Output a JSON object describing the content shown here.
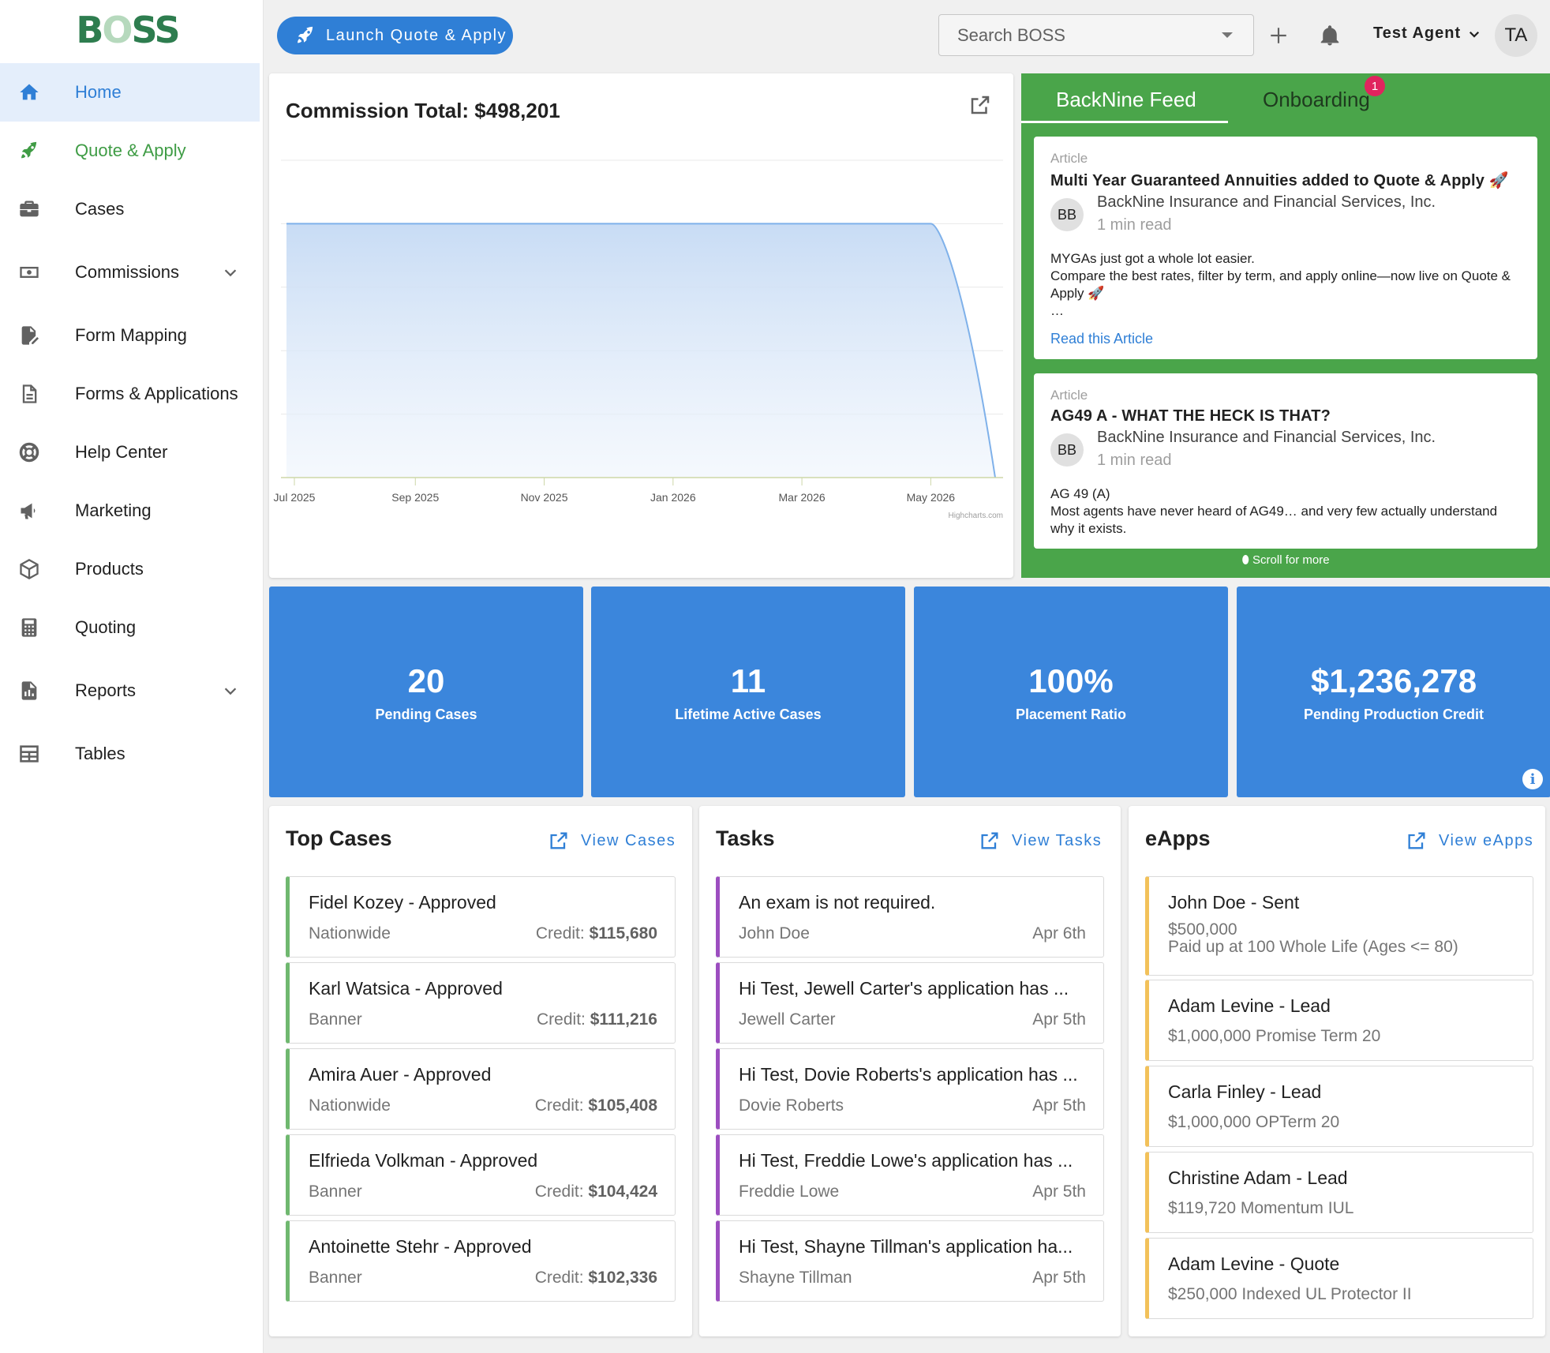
{
  "app": {
    "logo_text": "BOSS"
  },
  "sidebar": {
    "items": [
      {
        "label": "Home",
        "icon": "home-icon"
      },
      {
        "label": "Quote & Apply",
        "icon": "rocket-icon"
      },
      {
        "label": "Cases",
        "icon": "briefcase-icon"
      },
      {
        "label": "Commissions",
        "icon": "cash-icon"
      },
      {
        "label": "Form Mapping",
        "icon": "file-edit-icon"
      },
      {
        "label": "Forms & Applications",
        "icon": "file-document-icon"
      },
      {
        "label": "Help Center",
        "icon": "lifebuoy-icon"
      },
      {
        "label": "Marketing",
        "icon": "megaphone-icon"
      },
      {
        "label": "Products",
        "icon": "cube-icon"
      },
      {
        "label": "Quoting",
        "icon": "calculator-icon"
      },
      {
        "label": "Reports",
        "icon": "file-chart-icon"
      },
      {
        "label": "Tables",
        "icon": "table-icon"
      }
    ]
  },
  "topbar": {
    "launch_label": "Launch Quote & Apply",
    "search_placeholder": "Search BOSS",
    "user_name": "Test Agent",
    "user_initials": "TA"
  },
  "chart": {
    "title": "Commission Total: $498,201",
    "credit": "Highcharts.com"
  },
  "chart_data": {
    "type": "area",
    "title": "Commission Total: $498,201",
    "categories": [
      "Jul 2025",
      "Sep 2025",
      "Nov 2025",
      "Jan 2026",
      "Mar 2026",
      "May 2026"
    ],
    "x": [
      "Jul 2025",
      "Aug 2025",
      "Sep 2025",
      "Oct 2025",
      "Nov 2025",
      "Dec 2025",
      "Jan 2026",
      "Feb 2026",
      "Mar 2026",
      "Apr 2026",
      "May 2026",
      "Jun 2026"
    ],
    "series": [
      {
        "values": [
          498201,
          498201,
          498201,
          498201,
          498201,
          498201,
          498201,
          498201,
          498201,
          498201,
          498201,
          0
        ]
      }
    ],
    "grid": true,
    "xlabel": "",
    "ylabel": ""
  },
  "feed": {
    "tabs": [
      "BackNine Feed",
      "Onboarding"
    ],
    "onboarding_badge": "1",
    "articles": [
      {
        "kind": "Article",
        "title": "Multi Year Guaranteed Annuities added to Quote & Apply 🚀",
        "initials": "BB",
        "author": "BackNine Insurance and Financial Services, Inc.",
        "read_time": "1 min read",
        "body_lines": [
          "MYGAs just got a whole lot easier.",
          "Compare the best rates, filter by term, and apply online—now live on Quote & Apply 🚀",
          "…"
        ],
        "link": "Read this Article"
      },
      {
        "kind": "Article",
        "title": "AG49 A - WHAT THE HECK IS THAT?",
        "initials": "BB",
        "author": "BackNine Insurance and Financial Services, Inc.",
        "read_time": "1 min read",
        "body_lines": [
          "AG 49 (A)",
          "Most agents have never heard of AG49… and very few actually understand why it exists."
        ]
      }
    ],
    "scroll_more": "Scroll for more"
  },
  "stats": [
    {
      "value": "20",
      "label": "Pending Cases"
    },
    {
      "value": "11",
      "label": "Lifetime Active Cases"
    },
    {
      "value": "100%",
      "label": "Placement Ratio"
    },
    {
      "value": "$1,236,278",
      "label": "Pending Production Credit"
    }
  ],
  "top_cases": {
    "title": "Top Cases",
    "link": "View Cases",
    "credit_label": "Credit:",
    "items": [
      {
        "title": "Fidel Kozey - Approved",
        "carrier": "Nationwide",
        "credit": "$115,680"
      },
      {
        "title": "Karl Watsica - Approved",
        "carrier": "Banner",
        "credit": "$111,216"
      },
      {
        "title": "Amira Auer - Approved",
        "carrier": "Nationwide",
        "credit": "$105,408"
      },
      {
        "title": "Elfrieda Volkman - Approved",
        "carrier": "Banner",
        "credit": "$104,424"
      },
      {
        "title": "Antoinette Stehr - Approved",
        "carrier": "Banner",
        "credit": "$102,336"
      }
    ]
  },
  "tasks": {
    "title": "Tasks",
    "link": "View Tasks",
    "items": [
      {
        "title": "An exam is not required.",
        "person": "John Doe",
        "date": "Apr 6th"
      },
      {
        "title": "Hi Test, Jewell Carter's application has ...",
        "person": "Jewell Carter",
        "date": "Apr 5th"
      },
      {
        "title": "Hi Test, Dovie Roberts's application has ...",
        "person": "Dovie Roberts",
        "date": "Apr 5th"
      },
      {
        "title": "Hi Test, Freddie Lowe's application has ...",
        "person": "Freddie Lowe",
        "date": "Apr 5th"
      },
      {
        "title": "Hi Test, Shayne Tillman's application ha...",
        "person": "Shayne Tillman",
        "date": "Apr 5th"
      }
    ]
  },
  "eapps": {
    "title": "eApps",
    "link": "View eApps",
    "items": [
      {
        "title": "John Doe - Sent",
        "line1": "$500,000",
        "line2": "Paid up at 100 Whole Life (Ages <= 80)"
      },
      {
        "title": "Adam Levine - Lead",
        "line1": "$1,000,000 Promise Term 20"
      },
      {
        "title": "Carla Finley - Lead",
        "line1": "$1,000,000 OPTerm 20"
      },
      {
        "title": "Christine Adam - Lead",
        "line1": "$119,720 Momentum IUL"
      },
      {
        "title": "Adam Levine - Quote",
        "line1": "$250,000 Indexed UL Protector II"
      }
    ]
  },
  "colors": {
    "primary": "#2f7fd6",
    "stat_tile": "#3b86dc",
    "feed_green": "#4aa54a",
    "case_border": "#6fb86f",
    "task_border": "#9c4ec0",
    "eapp_border": "#f2c15a",
    "badge": "#e0245e"
  }
}
